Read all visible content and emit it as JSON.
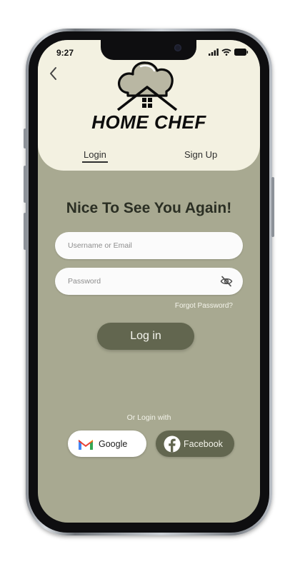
{
  "status_bar": {
    "time": "9:27"
  },
  "brand": {
    "name": "HOME CHEF"
  },
  "tabs": [
    {
      "label": "Login",
      "active": true
    },
    {
      "label": "Sign Up",
      "active": false
    }
  ],
  "heading": "Nice To See You Again!",
  "form": {
    "username_placeholder": "Username or Email",
    "password_placeholder": "Password",
    "forgot_label": "Forgot Password?",
    "login_label": "Log in"
  },
  "social": {
    "caption": "Or Login with",
    "google_label": "Google",
    "facebook_label": "Facebook"
  },
  "colors": {
    "screen_bg": "#a8a991",
    "header_bg": "#f3f1e1",
    "primary_button": "#62664f"
  },
  "icons": [
    "back-chevron-icon",
    "signal-icon",
    "wifi-icon",
    "battery-icon",
    "eye-off-icon",
    "gmail-icon",
    "facebook-icon",
    "chef-hat-house-logo"
  ]
}
